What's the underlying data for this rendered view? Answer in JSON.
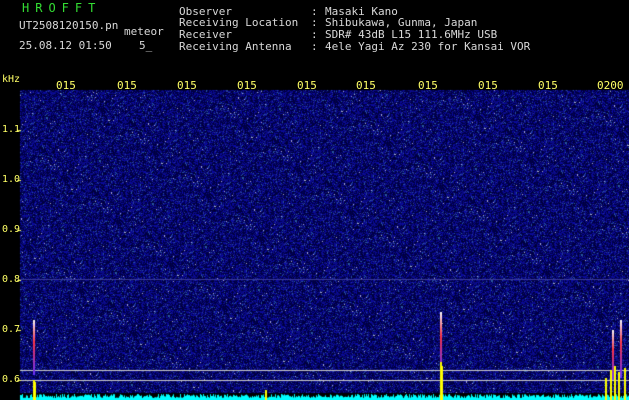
{
  "header": {
    "app_title": "HROFFT",
    "file_name": "UT2508120150.pn",
    "meteor_label": "meteor",
    "date_time": "25.08.12 01:50",
    "count": "5_"
  },
  "info": [
    {
      "key": "Observer",
      "sep": ":",
      "value": "Masaki Kano"
    },
    {
      "key": "Receiving Location",
      "sep": ":",
      "value": "Shibukawa, Gunma, Japan"
    },
    {
      "key": "Receiver",
      "sep": ":",
      "value": "SDR# 43dB L15 111.6MHz USB"
    },
    {
      "key": "Receiving Antenna",
      "sep": ":",
      "value": "4ele Yagi Az 230 for Kansai VOR"
    }
  ],
  "axis": {
    "unit": "kHz",
    "y_labels": [
      "1.1",
      "1.0",
      "0.9",
      "0.8",
      "0.7",
      "0.6"
    ],
    "time_labels": [
      "015",
      "015",
      "015",
      "015",
      "015",
      "015",
      "015",
      "015",
      "015",
      "0200"
    ]
  },
  "colors": {
    "background": "#000000",
    "spectrogram_noise": "#1a1a8c",
    "labels": "#ffff66",
    "title": "#33dd33",
    "meteor_echo": "#ff3344",
    "signal_level": "#00ffff"
  }
}
